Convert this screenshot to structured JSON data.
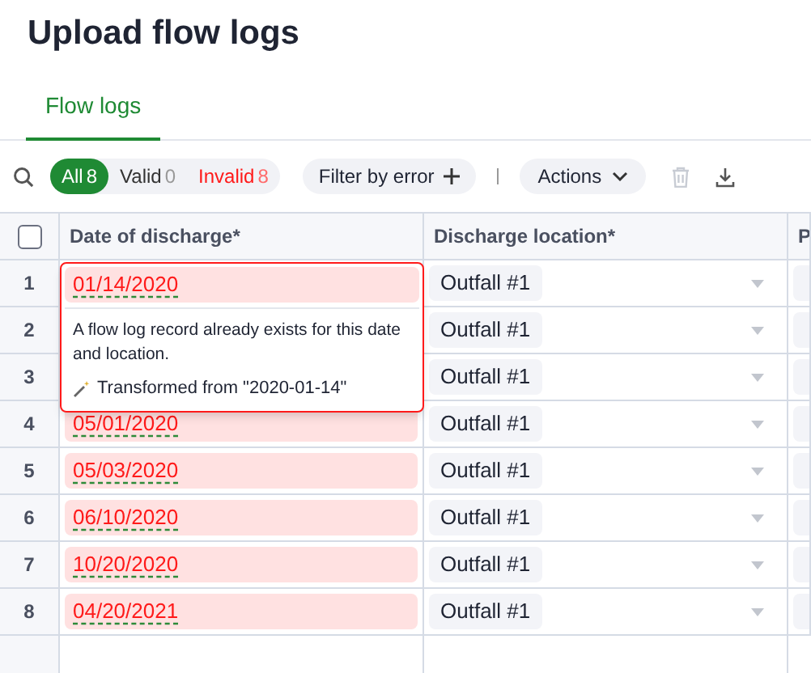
{
  "title": "Upload flow logs",
  "tabs": [
    {
      "label": "Flow logs",
      "selected": true
    }
  ],
  "toolbar": {
    "filters": [
      {
        "kind": "all",
        "label": "All",
        "count": "8",
        "selected": true
      },
      {
        "kind": "valid",
        "label": "Valid",
        "count": "0",
        "selected": false
      },
      {
        "kind": "invalid",
        "label": "Invalid",
        "count": "8",
        "selected": false
      }
    ],
    "filter_button": "Filter by error",
    "actions_button": "Actions",
    "delete_disabled": true
  },
  "table": {
    "select_all_checked": false,
    "columns": [
      "Date of discharge*",
      "Discharge location*",
      "P"
    ],
    "rows": [
      {
        "number": "1",
        "date": "01/14/2020",
        "invalid": true,
        "location": "Outfall #1",
        "popover": {
          "message": "A flow log record already exists for this date and location.",
          "note": "Transformed from \"2020-01-14\""
        }
      },
      {
        "number": "2",
        "location": "Outfall #1"
      },
      {
        "number": "3",
        "location": "Outfall #1"
      },
      {
        "number": "4",
        "date": "05/01/2020",
        "invalid": true,
        "location": "Outfall #1"
      },
      {
        "number": "5",
        "date": "05/03/2020",
        "invalid": true,
        "location": "Outfall #1"
      },
      {
        "number": "6",
        "date": "06/10/2020",
        "invalid": true,
        "location": "Outfall #1"
      },
      {
        "number": "7",
        "date": "10/20/2020",
        "invalid": true,
        "location": "Outfall #1"
      },
      {
        "number": "8",
        "date": "04/20/2021",
        "invalid": true,
        "location": "Outfall #1"
      }
    ]
  }
}
